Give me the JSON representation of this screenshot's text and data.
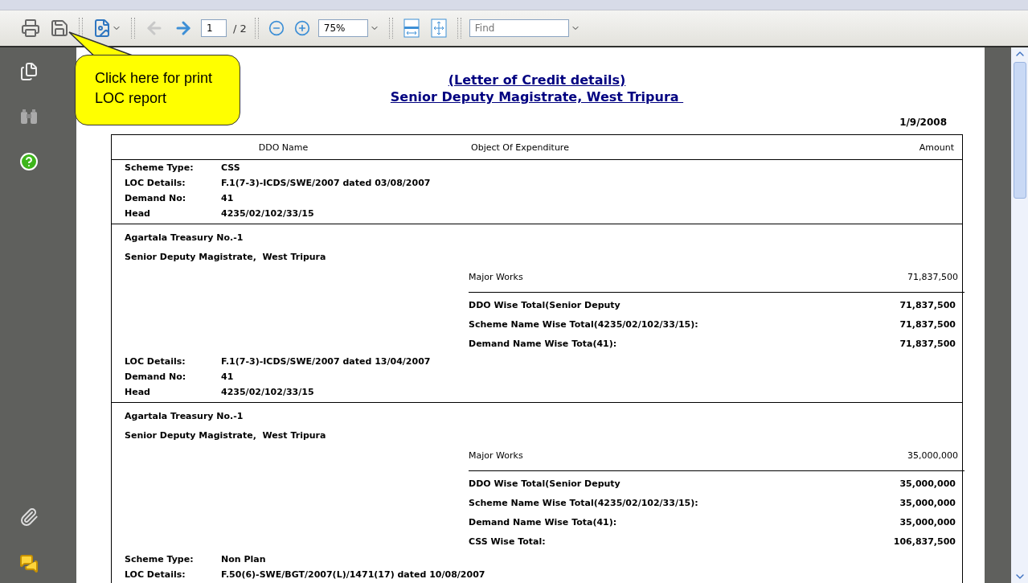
{
  "toolbar": {
    "prev_page": {
      "disabled": true
    },
    "next_page": {
      "disabled": false
    },
    "page_number": "1",
    "page_total": "/ 2",
    "zoom": "75%",
    "find_placeholder": "Find"
  },
  "callout": {
    "text": "Click here for print LOC report"
  },
  "report": {
    "title_lines": [
      "(Letter of Credit details)",
      "Senior Deputy Magistrate, West Tripura "
    ],
    "date": "1/9/2008",
    "columns": [
      "DDO Name",
      "Object Of Expenditure",
      "Amount"
    ],
    "sections": [
      {
        "kind": "loc",
        "rows": [
          {
            "label": "Scheme Type:",
            "value": "CSS"
          },
          {
            "label": "LOC Details:",
            "value": "F.1(7-3)-ICDS/SWE/2007 dated 03/08/2007"
          },
          {
            "label": "Demand No:",
            "value": "41"
          },
          {
            "label": "Head",
            "value": "4235/02/102/33/15"
          }
        ]
      },
      {
        "kind": "ddo",
        "treasury": "Agartala Treasury No.-1",
        "office": "Senior Deputy Magistrate,  West Tripura",
        "object": "Major Works",
        "amount": "71,837,500",
        "totals": [
          {
            "label": "DDO Wise Total(Senior Deputy",
            "amount": "71,837,500"
          },
          {
            "label": "Scheme Name Wise Total(4235/02/102/33/15):",
            "amount": "71,837,500"
          },
          {
            "label": "Demand Name Wise Tota(41):",
            "amount": "71,837,500"
          }
        ]
      },
      {
        "kind": "loc",
        "rows": [
          {
            "label": "LOC Details:",
            "value": "F.1(7-3)-ICDS/SWE/2007 dated 13/04/2007"
          },
          {
            "label": "Demand No:",
            "value": "41"
          },
          {
            "label": "Head",
            "value": "4235/02/102/33/15"
          }
        ]
      },
      {
        "kind": "ddo",
        "treasury": "Agartala Treasury No.-1",
        "office": "Senior Deputy Magistrate,  West Tripura",
        "object": "Major Works",
        "amount": "35,000,000",
        "totals": [
          {
            "label": "DDO Wise Total(Senior Deputy",
            "amount": "35,000,000"
          },
          {
            "label": "Scheme Name Wise Total(4235/02/102/33/15):",
            "amount": "35,000,000"
          },
          {
            "label": "Demand Name Wise Tota(41):",
            "amount": "35,000,000"
          },
          {
            "label": "CSS Wise Total:",
            "amount": "106,837,500"
          }
        ]
      },
      {
        "kind": "loc",
        "rows": [
          {
            "label": "Scheme Type:",
            "value": "Non Plan"
          },
          {
            "label": "LOC Details:",
            "value": "F.50(6)-SWE/BGT/2007(L)/1471(17) dated 10/08/2007"
          }
        ]
      }
    ]
  }
}
